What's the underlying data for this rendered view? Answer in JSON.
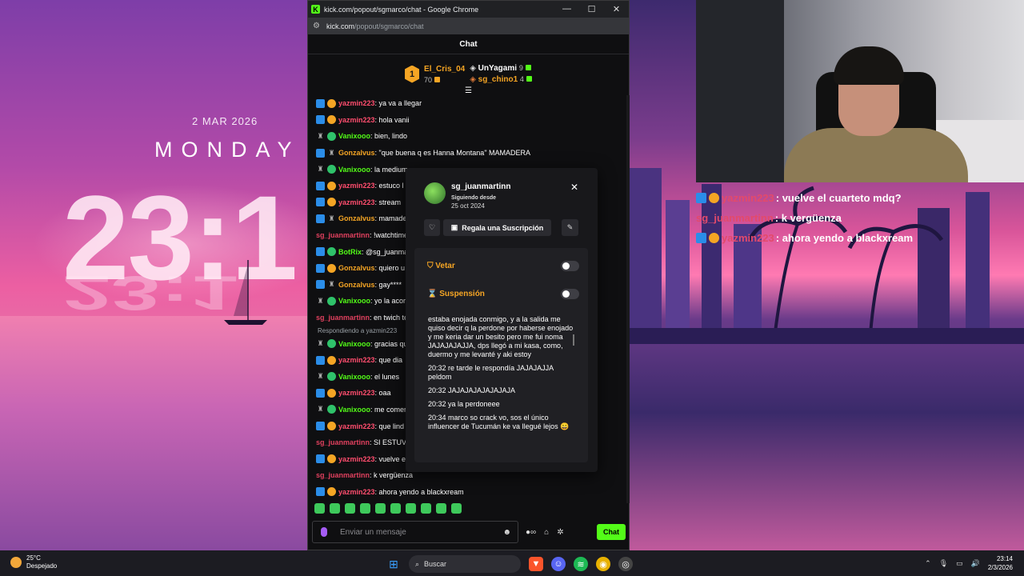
{
  "wallpaper": {
    "date": "2 MAR 2026",
    "day": "MONDAY",
    "time": "23:1"
  },
  "overlay_chat": [
    {
      "user": "yazmin223",
      "text": ": vuelve el cuarteto mdq?",
      "badges": true
    },
    {
      "user": "sg_juanmartinn",
      "text": ": k vergüenza",
      "badges": false
    },
    {
      "user": "yazmin223",
      "text": ": ahora yendo a blackxream",
      "badges": true
    }
  ],
  "browser": {
    "title": "kick.com/popout/sgmarco/chat - Google Chrome",
    "url_host": "kick.com",
    "url_path": "/popout/sgmarco/chat",
    "controls": [
      "—",
      "☐",
      "✕"
    ]
  },
  "chat": {
    "header": "Chat",
    "leaderboard": {
      "first": {
        "rank": "1",
        "name": "El_Cris_04",
        "count": "70"
      },
      "second": {
        "name": "UnYagami",
        "count": "9"
      },
      "third": {
        "name": "sg_chino1",
        "count": "4"
      }
    },
    "messages": [
      {
        "name": "yazmin223",
        "text": ": ya va a llegar",
        "style": "pink",
        "badges": [
          "blue",
          "gold"
        ]
      },
      {
        "name": "yazmin223",
        "text": ": hola vanii",
        "style": "pink",
        "badges": [
          "blue",
          "gold"
        ]
      },
      {
        "name": "Vanixooo",
        "text": ": bien, lindo",
        "style": "green",
        "badges": [
          "gray",
          "green"
        ]
      },
      {
        "name": "Gonzalvus",
        "text": ": \"que buena q es Hanna Montana\" MAMADERA",
        "style": "orange",
        "badges": [
          "blue",
          "gray"
        ]
      },
      {
        "name": "Vanixooo",
        "text": ": la medium",
        "style": "green",
        "badges": [
          "gray",
          "green"
        ]
      },
      {
        "name": "yazmin223",
        "text": ": estuco l",
        "style": "pink",
        "badges": [
          "blue",
          "gold"
        ]
      },
      {
        "name": "yazmin223",
        "text": ": stream",
        "style": "pink",
        "badges": [
          "blue",
          "gold"
        ]
      },
      {
        "name": "Gonzalvus",
        "text": ": mamade",
        "style": "orange",
        "badges": [
          "blue",
          "gray"
        ]
      },
      {
        "name": "sg_juanmartinn",
        "text": ": !watchtime",
        "style": "red",
        "badges": []
      },
      {
        "name": "BotRix",
        "text": ": @sg_juanma",
        "style": "green",
        "badges": [
          "blue",
          "green"
        ]
      },
      {
        "name": "Gonzalvus",
        "text": ": quiero u",
        "style": "orange",
        "badges": [
          "blue",
          "gold"
        ]
      },
      {
        "name": "Gonzalvus",
        "text": ": gay****",
        "style": "orange",
        "badges": [
          "blue",
          "gray"
        ]
      },
      {
        "name": "Vanixooo",
        "text": ": yo la acor",
        "style": "green",
        "badges": [
          "gray",
          "green"
        ]
      },
      {
        "name": "sg_juanmartinn",
        "text": ": en twich te",
        "style": "red",
        "badges": []
      },
      {
        "reply": "Respondiendo a yazmin223"
      },
      {
        "name": "Vanixooo",
        "text": ": gracias qu",
        "style": "green",
        "badges": [
          "gray",
          "green"
        ]
      },
      {
        "name": "yazmin223",
        "text": ": que dia",
        "style": "pink",
        "badges": [
          "blue",
          "gold"
        ]
      },
      {
        "name": "Vanixooo",
        "text": ": el lunes",
        "style": "green",
        "badges": [
          "gray",
          "green"
        ]
      },
      {
        "name": "yazmin223",
        "text": ": oaa",
        "style": "pink",
        "badges": [
          "blue",
          "gold"
        ]
      },
      {
        "name": "Vanixooo",
        "text": ": me comer",
        "style": "green",
        "badges": [
          "gray",
          "green"
        ]
      },
      {
        "name": "yazmin223",
        "text": ": que lind",
        "style": "pink",
        "badges": [
          "blue",
          "gold"
        ]
      },
      {
        "name": "sg_juanmartinn",
        "text": ": SI ESTUVE",
        "style": "red",
        "badges": []
      },
      {
        "name": "yazmin223",
        "text": ": vuelve e",
        "style": "pink",
        "badges": [
          "blue",
          "gold"
        ]
      },
      {
        "name": "sg_juanmartinn",
        "text": ": k vergüenza",
        "style": "red",
        "badges": []
      },
      {
        "name": "yazmin223",
        "text": ": ahora yendo a blackxream",
        "style": "pink",
        "badges": [
          "blue",
          "gold"
        ]
      }
    ],
    "input_placeholder": "Enviar un mensaje",
    "send_label": "Chat"
  },
  "user_card": {
    "username": "sg_juanmartinn",
    "following_label": "Siguiendo desde",
    "following_date": "25 oct 2024",
    "gift_label": "Regala una Suscripción",
    "veto_label": "Vetar",
    "suspend_label": "Suspensión",
    "veto_on": false,
    "suspend_on": false,
    "history": [
      "estaba enojada conmigo, y a la salida me quiso decir q la perdone por haberse enojado y me keria dar un besito pero me fui noma JAJAJAJAJJA, dps llegó a mi kasa, como, duermo y me levanté y aki estoy",
      "20:32 re tarde le respondía JAJAJAJJA peldom",
      "20:32 JAJAJAJAJAJAJAJA",
      "20:32 ya la perdoneee",
      "20:34 marco so crack vo, sos el único influencer de Tucumán ke va llegué lejos 😄"
    ]
  },
  "taskbar": {
    "temperature": "25°C",
    "weather": "Despejado",
    "search_label": "Buscar",
    "time": "23:14",
    "date": "2/3/2026"
  },
  "colors": {
    "kick_green": "#53fc18",
    "gold": "#f5a524",
    "pink_user": "#ff4d6e"
  }
}
